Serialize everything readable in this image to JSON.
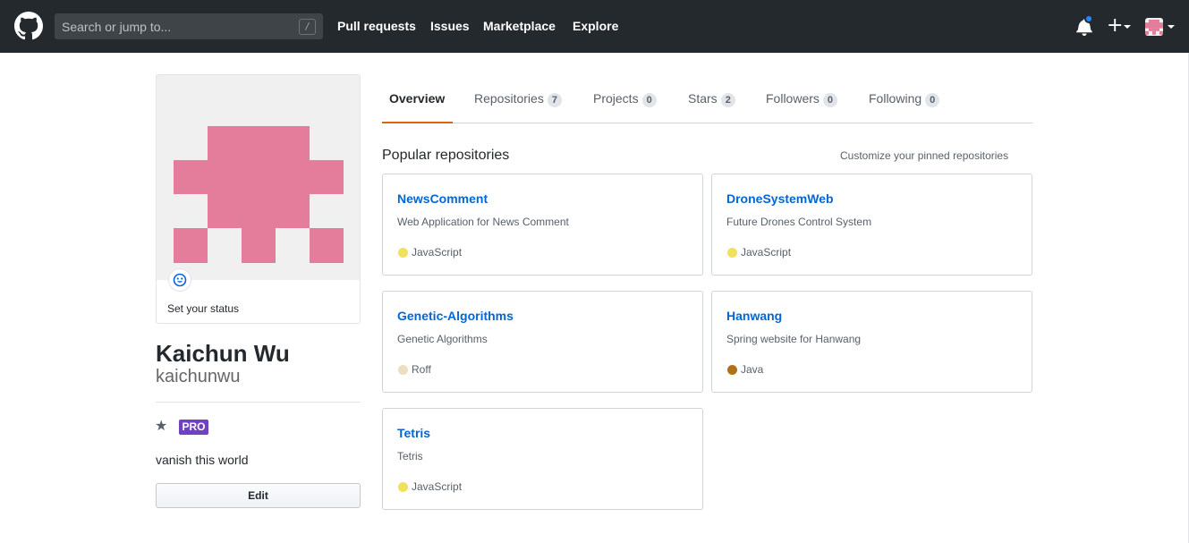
{
  "header": {
    "search_placeholder": "Search or jump to...",
    "search_shortcut": "/",
    "nav": [
      "Pull requests",
      "Issues",
      "Marketplace",
      "Explore"
    ],
    "plus_label": "+"
  },
  "profile": {
    "status": "Set your status",
    "fullname": "Kaichun Wu",
    "username": "kaichunwu",
    "badge": "PRO",
    "bio": "vanish this world",
    "edit_label": "Edit",
    "avatar_color": "#e37d9b"
  },
  "tabs": [
    {
      "label": "Overview",
      "count": null
    },
    {
      "label": "Repositories",
      "count": "7"
    },
    {
      "label": "Projects",
      "count": "0"
    },
    {
      "label": "Stars",
      "count": "2"
    },
    {
      "label": "Followers",
      "count": "0"
    },
    {
      "label": "Following",
      "count": "0"
    }
  ],
  "popular": {
    "title": "Popular repositories",
    "customize": "Customize your pinned repositories"
  },
  "repos": [
    {
      "name": "NewsComment",
      "desc": "Web Application for News Comment",
      "lang": "JavaScript",
      "lang_color": "#f1e05a"
    },
    {
      "name": "DroneSystemWeb",
      "desc": "Future Drones Control System",
      "lang": "JavaScript",
      "lang_color": "#f1e05a"
    },
    {
      "name": "Genetic-Algorithms",
      "desc": "Genetic Algorithms",
      "lang": "Roff",
      "lang_color": "#ecdebe"
    },
    {
      "name": "Hanwang",
      "desc": "Spring website for Hanwang",
      "lang": "Java",
      "lang_color": "#b07219"
    },
    {
      "name": "Tetris",
      "desc": "Tetris",
      "lang": "JavaScript",
      "lang_color": "#f1e05a"
    }
  ]
}
